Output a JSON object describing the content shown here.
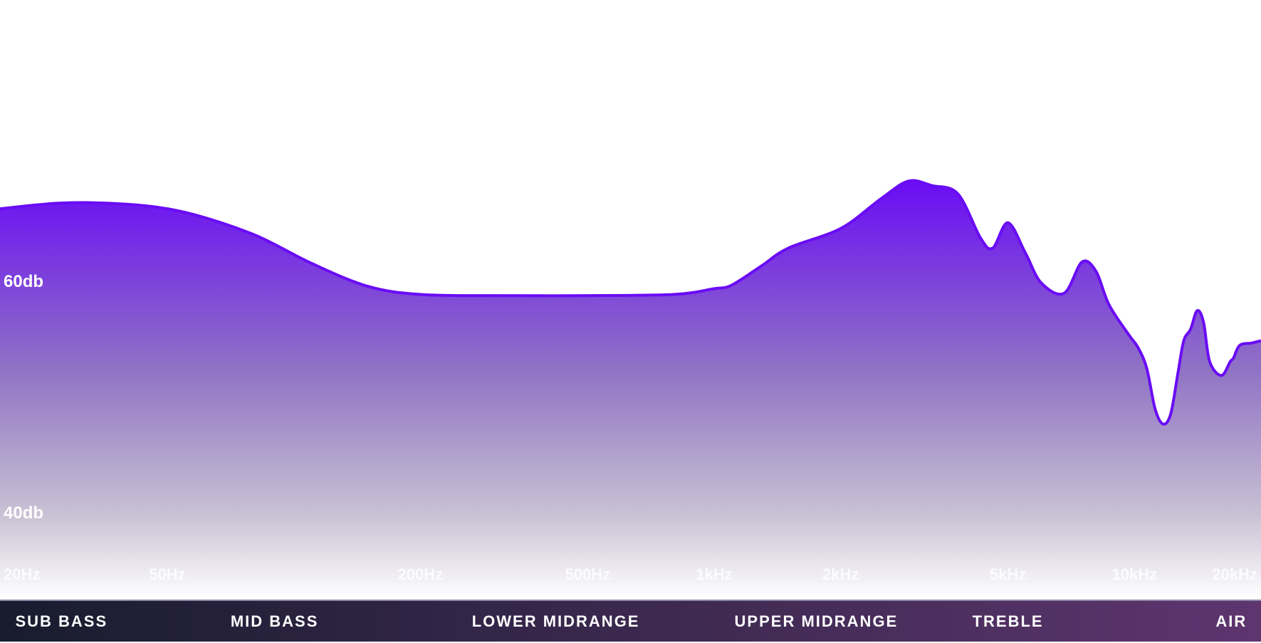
{
  "colors": {
    "curve": "#6a0cf5",
    "fill_top": "#6a0cf5",
    "fill_bottom": "#ffffff",
    "band_bar_start": "#181c2e",
    "band_bar_end": "#5e356f",
    "label": "#ffffff"
  },
  "chart_data": {
    "type": "area",
    "title": "",
    "xlabel": "",
    "ylabel": "",
    "x_scale": "log",
    "xlim": [
      20,
      20000
    ],
    "y_ticks": [
      {
        "value": 60,
        "label": "60db"
      },
      {
        "value": 40,
        "label": "40db"
      }
    ],
    "x_ticks": [
      {
        "value": 20,
        "label": "20Hz"
      },
      {
        "value": 50,
        "label": "50Hz"
      },
      {
        "value": 200,
        "label": "200Hz"
      },
      {
        "value": 500,
        "label": "500Hz"
      },
      {
        "value": 1000,
        "label": "1kHz"
      },
      {
        "value": 2000,
        "label": "2kHz"
      },
      {
        "value": 5000,
        "label": "5kHz"
      },
      {
        "value": 10000,
        "label": "10kHz"
      },
      {
        "value": 20000,
        "label": "20kHz"
      }
    ],
    "series": [
      {
        "x": [
          20,
          28,
          40,
          55,
          80,
          110,
          150,
          200,
          300,
          500,
          800,
          1000,
          1100,
          1300,
          1500,
          2000,
          2500,
          2900,
          3300,
          3800,
          4300,
          4600,
          5000,
          5500,
          6000,
          6800,
          7500,
          8100,
          8700,
          9700,
          10200,
          10700,
          11200,
          11700,
          12200,
          12700,
          13100,
          13600,
          14100,
          14600,
          15100,
          16100,
          16900,
          17200,
          17800,
          19000,
          20000
        ],
        "y": [
          66.2,
          66.7,
          66.6,
          65.9,
          64.0,
          61.5,
          59.5,
          58.8,
          58.7,
          58.7,
          58.8,
          59.3,
          59.6,
          61.3,
          62.8,
          64.5,
          67.1,
          68.6,
          68.2,
          67.5,
          63.7,
          62.8,
          65.0,
          62.4,
          59.8,
          58.9,
          61.6,
          60.8,
          57.9,
          55.3,
          54.2,
          52.4,
          48.9,
          47.6,
          48.5,
          52.1,
          54.8,
          55.8,
          57.4,
          56.4,
          53.0,
          51.8,
          53.0,
          53.3,
          54.4,
          54.6,
          54.8
        ]
      }
    ],
    "bands": [
      {
        "label": "SUB BASS",
        "center_x": 28
      },
      {
        "label": "MID BASS",
        "center_x": 90
      },
      {
        "label": "LOWER MIDRANGE",
        "center_x": 420
      },
      {
        "label": "UPPER MIDRANGE",
        "center_x": 1750
      },
      {
        "label": "TREBLE",
        "center_x": 5000
      },
      {
        "label": "AIR",
        "center_x": 17000
      }
    ]
  }
}
